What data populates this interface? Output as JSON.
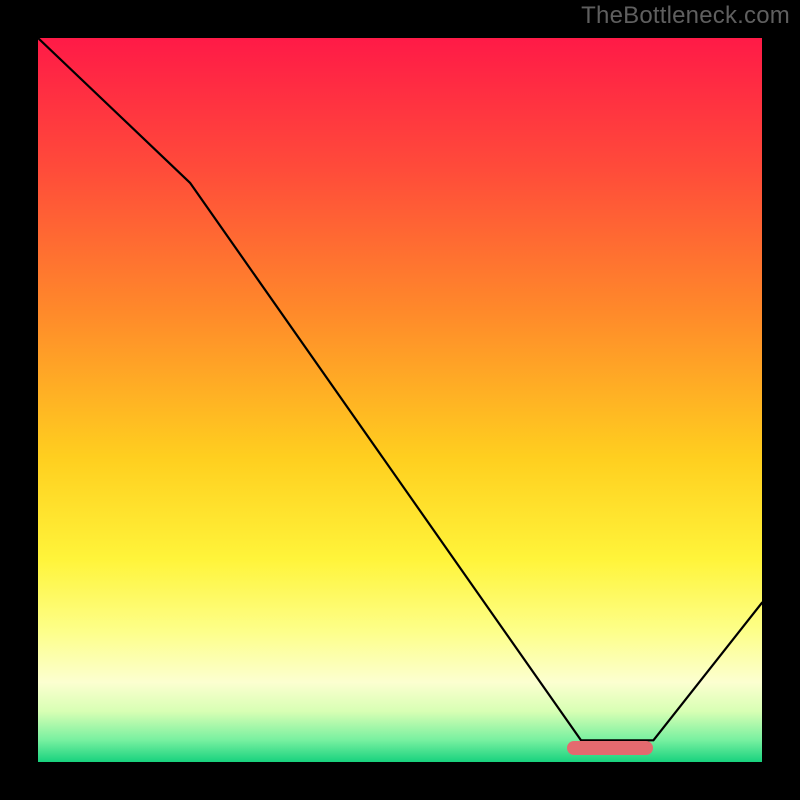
{
  "watermark": "TheBottleneck.com",
  "chart_data": {
    "type": "line",
    "title": "",
    "xlabel": "",
    "ylabel": "",
    "xlim": [
      0,
      100
    ],
    "ylim": [
      0,
      100
    ],
    "series": [
      {
        "name": "bottleneck-curve",
        "x": [
          0,
          21,
          75,
          85,
          100
        ],
        "y": [
          100,
          80,
          3,
          3,
          22
        ],
        "color": "#000000"
      }
    ],
    "marker": {
      "name": "optimal-range-pill",
      "x_start": 73,
      "x_end": 85,
      "y": 2,
      "color": "#e46a6f"
    },
    "background_gradient": {
      "stops": [
        {
          "offset": 0.0,
          "color": "#ff1a47"
        },
        {
          "offset": 0.18,
          "color": "#ff4b3a"
        },
        {
          "offset": 0.38,
          "color": "#ff8a2a"
        },
        {
          "offset": 0.58,
          "color": "#ffcf1f"
        },
        {
          "offset": 0.72,
          "color": "#fff43a"
        },
        {
          "offset": 0.82,
          "color": "#fdff8a"
        },
        {
          "offset": 0.89,
          "color": "#fcffd0"
        },
        {
          "offset": 0.93,
          "color": "#d8ffb4"
        },
        {
          "offset": 0.97,
          "color": "#77f0a0"
        },
        {
          "offset": 1.0,
          "color": "#18d27e"
        }
      ]
    }
  }
}
